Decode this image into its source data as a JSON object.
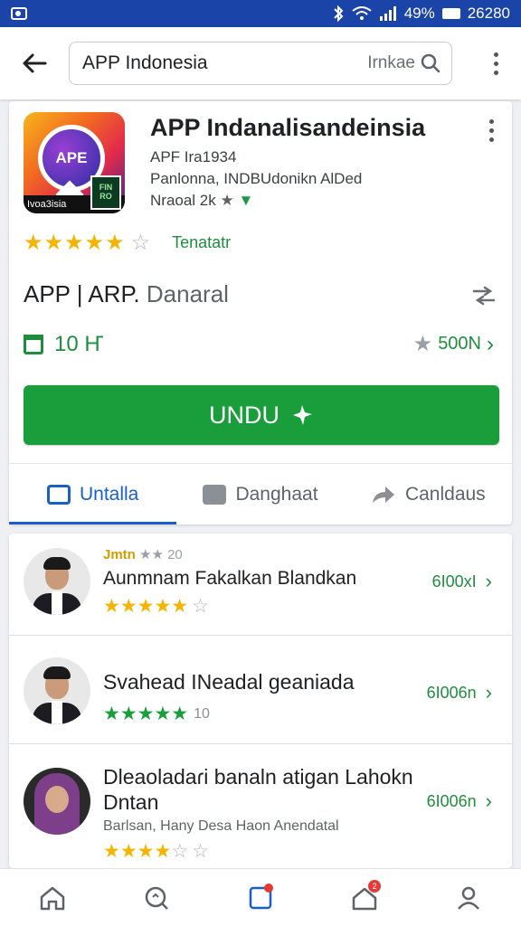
{
  "status_bar": {
    "battery": "49%",
    "time": "26280"
  },
  "search": {
    "query": "APP Indonesia",
    "hint": "Irnkae"
  },
  "app": {
    "icon_label": "APE",
    "icon_bottom_label": "Ivoa3isia",
    "icon_qr_label": "FIN RO",
    "title": "APP Indanalisandeinsia",
    "meta1": "APF Ira1934",
    "meta2": "Panlonna, INDBUdonikn AlDed",
    "meta3": "Nraoal 2k",
    "rating_label": "Tenatatr",
    "developer_part1": "APP | ARP.",
    "developer_part2": "Danaral",
    "stat_left": "10  Ҥ",
    "stat_right": "500N",
    "install_label": "UNDU"
  },
  "tabs": [
    {
      "label": "Untalla"
    },
    {
      "label": "Danghaat"
    },
    {
      "label": "Canldaus"
    }
  ],
  "list": [
    {
      "top_prefix": "Jmtn",
      "top_suffix": "20",
      "name": "Aunmnam Fakalkan Blandkan",
      "right": "6I00хI"
    },
    {
      "name": "Svahead INeadal geaniada",
      "stars_tail": "10",
      "right": "6I006n"
    },
    {
      "name": "Dleaoladaɾi banaln atigan Lahokn Dntan",
      "sub": "Barlsan, Hany Desa Haon Anendatal",
      "right": "6I006n"
    }
  ],
  "colors": {
    "status_bar": "#1a44a8",
    "accent_green": "#1a9d3b",
    "accent_blue": "#1a5fc8",
    "star": "#f4b400"
  },
  "icons": [
    "back-arrow-icon",
    "search-icon",
    "more-vert-icon",
    "share-icon",
    "calendar-icon",
    "star-icon",
    "chevron-right-icon",
    "home-icon",
    "discover-icon",
    "apps-icon",
    "notifications-icon",
    "profile-icon"
  ]
}
